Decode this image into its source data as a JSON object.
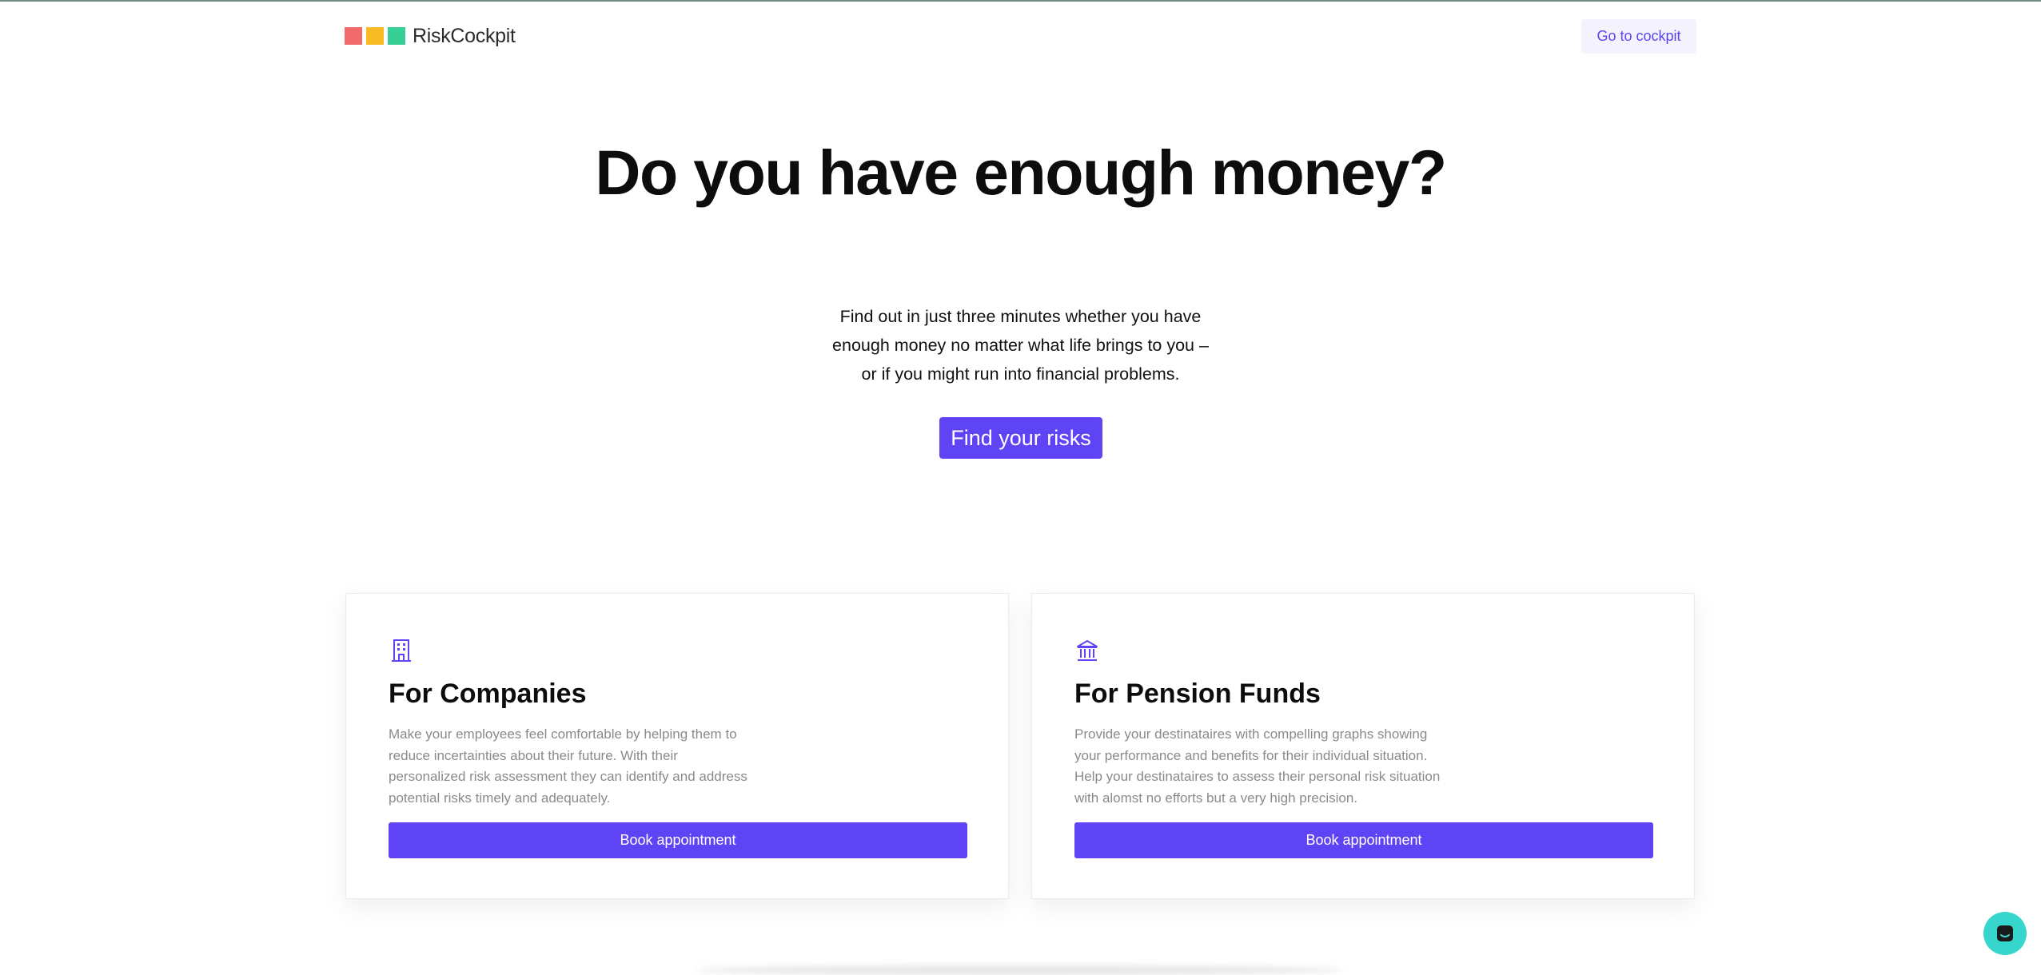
{
  "header": {
    "logo_text": "RiskCockpit",
    "logo_colors": [
      "#f26b6b",
      "#f8bb24",
      "#37cf95"
    ],
    "cockpit_button": "Go to cockpit"
  },
  "hero": {
    "title": "Do you have enough money?",
    "text_lines": [
      "Find out in just three minutes whether you have",
      "enough money no matter what life brings to you –",
      "or if you might run into financial problems."
    ],
    "cta": "Find your risks"
  },
  "cards": [
    {
      "icon": "building-icon",
      "title": "For Companies",
      "desc_lines": [
        "Make your employees feel comfortable by helping them to",
        "reduce incertainties about their future. With their",
        "personalized risk assessment they can identify and address",
        "potential risks timely and adequately."
      ],
      "button": "Book appointment"
    },
    {
      "icon": "bank-icon",
      "title": "For Pension Funds",
      "desc_lines": [
        "Provide your destinataires with compelling graphs showing",
        "your performance and benefits for their individual situation.",
        "Help your destinataires to assess their personal risk situation",
        "with alomst no efforts but a very high precision."
      ],
      "button": "Book appointment"
    }
  ],
  "colors": {
    "accent": "#5e44f5",
    "chat": "#37d6cc"
  },
  "chat_icon": "chat-icon"
}
